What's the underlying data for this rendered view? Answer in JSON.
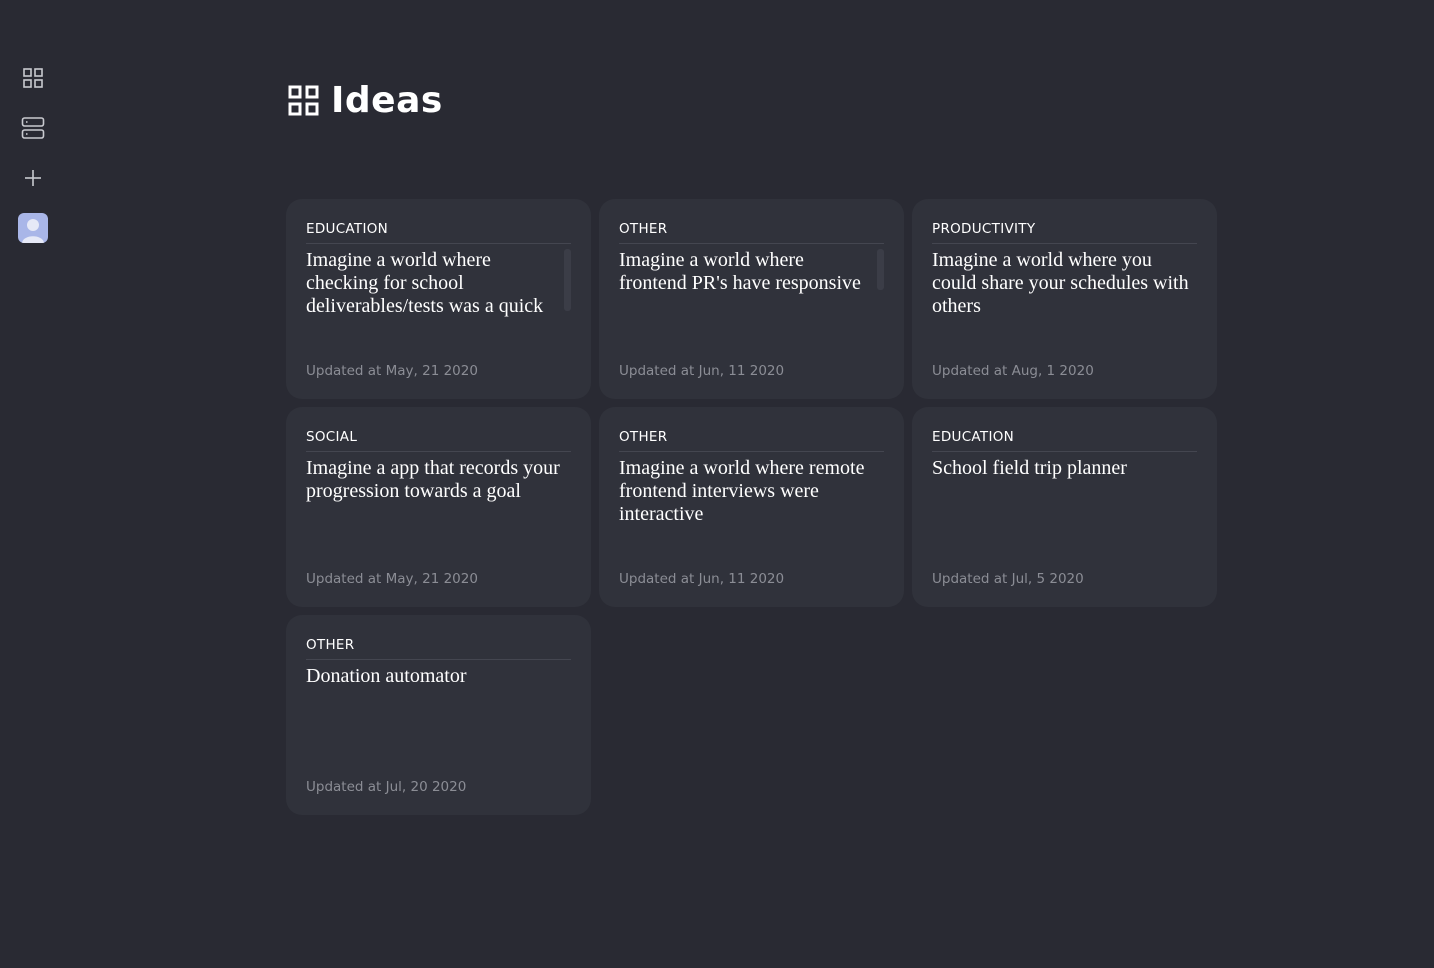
{
  "page": {
    "title": "Ideas"
  },
  "sidebar": {
    "items": [
      {
        "icon": "grid-icon"
      },
      {
        "icon": "list-icon"
      },
      {
        "icon": "plus-icon"
      },
      {
        "icon": "avatar"
      }
    ]
  },
  "ideas": [
    {
      "category": "EDUCATION",
      "title": "Imagine a world where checking for school deliverables/tests was a quick",
      "updated": "Updated at May, 21 2020"
    },
    {
      "category": "OTHER",
      "title": "Imagine a world where frontend PR's have responsive previews",
      "updated": "Updated at Jun, 11 2020"
    },
    {
      "category": "PRODUCTIVITY",
      "title": "Imagine a world where you could share your schedules with others",
      "updated": "Updated at Aug, 1 2020"
    },
    {
      "category": "SOCIAL",
      "title": "Imagine a app that records your progression towards a goal",
      "updated": "Updated at May, 21 2020"
    },
    {
      "category": "OTHER",
      "title": "Imagine a world where remote frontend interviews were interactive",
      "updated": "Updated at Jun, 11 2020"
    },
    {
      "category": "EDUCATION",
      "title": "School field trip planner",
      "updated": "Updated at Jul, 5 2020"
    },
    {
      "category": "OTHER",
      "title": "Donation automator",
      "updated": "Updated at Jul, 20 2020"
    }
  ],
  "colors": {
    "background": "#292a33",
    "card": "#30323b",
    "muted_text": "#8b8d95",
    "avatar": "#a9b6e8"
  }
}
